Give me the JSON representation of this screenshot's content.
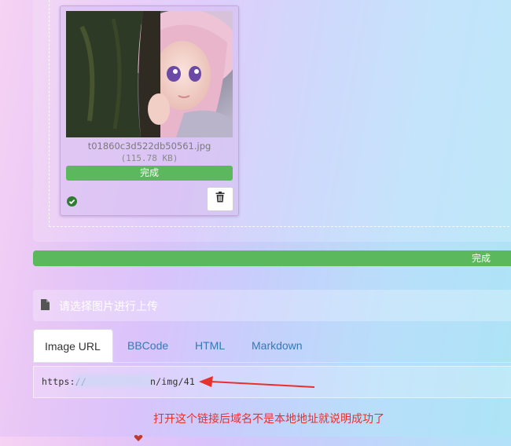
{
  "file": {
    "name": "t01860c3d522db50561.jpg",
    "size": "(115.78 KB)",
    "status": "完成"
  },
  "upload": {
    "total_status": "完成",
    "select_prompt": "请选择图片进行上传"
  },
  "tabs": [
    {
      "label": "Image URL",
      "active": true
    },
    {
      "label": "BBCode",
      "active": false
    },
    {
      "label": "HTML",
      "active": false
    },
    {
      "label": "Markdown",
      "active": false
    }
  ],
  "output": {
    "url_start": "https://",
    "url_end": "n/img/41"
  },
  "annotation": "打开这个链接后域名不是本地地址就说明成功了",
  "colors": {
    "success": "#5cb85c",
    "annotation": "#e8302c",
    "link": "#337ab7"
  }
}
